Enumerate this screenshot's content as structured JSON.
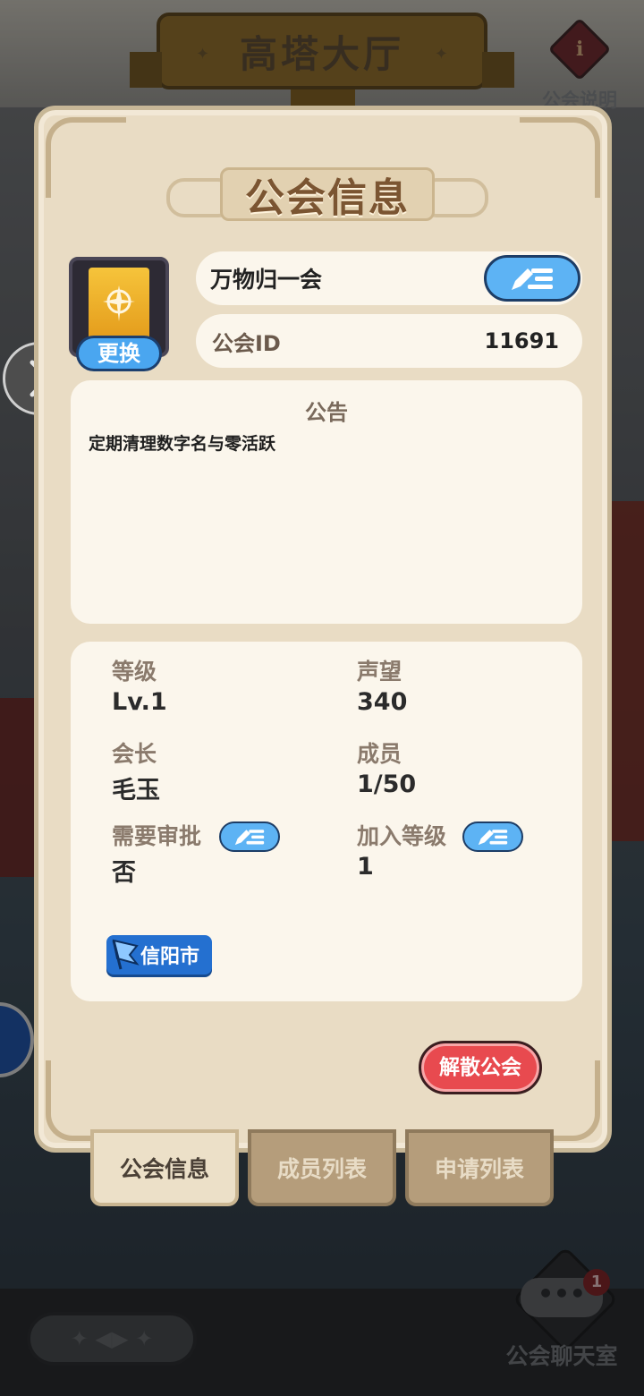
{
  "hall": {
    "title": "高塔大厅"
  },
  "guild_help": {
    "label": "公会说明",
    "icon_glyph": "i"
  },
  "panel": {
    "title": "公会信息"
  },
  "guild": {
    "name": "万物归一会",
    "change_label": "更换",
    "id_label": "公会ID",
    "id_value": "11691"
  },
  "notice": {
    "title": "公告",
    "text": "定期清理数字名与零活跃"
  },
  "stats": {
    "level_label": "等级",
    "level_value": "Lv.1",
    "prestige_label": "声望",
    "prestige_value": "340",
    "leader_label": "会长",
    "leader_value": "毛玉",
    "members_label": "成员",
    "members_value": "1/50",
    "approval_label": "需要审批",
    "approval_value": "否",
    "join_level_label": "加入等级",
    "join_level_value": "1",
    "city": "信阳市"
  },
  "actions": {
    "disband_label": "解散公会"
  },
  "tabs": [
    {
      "label": "公会信息",
      "active": true
    },
    {
      "label": "成员列表",
      "active": false
    },
    {
      "label": "申请列表",
      "active": false
    }
  ],
  "chat": {
    "label": "公会聊天室",
    "badge": "1",
    "bubble": "•••"
  },
  "colors": {
    "panel_bg": "#e9dcc4",
    "card_bg": "#fbf6ec",
    "blue_button": "#5db3f4",
    "red_button": "#e84a4f",
    "city_tag": "#2470d0",
    "title_brown": "#7b5532"
  }
}
